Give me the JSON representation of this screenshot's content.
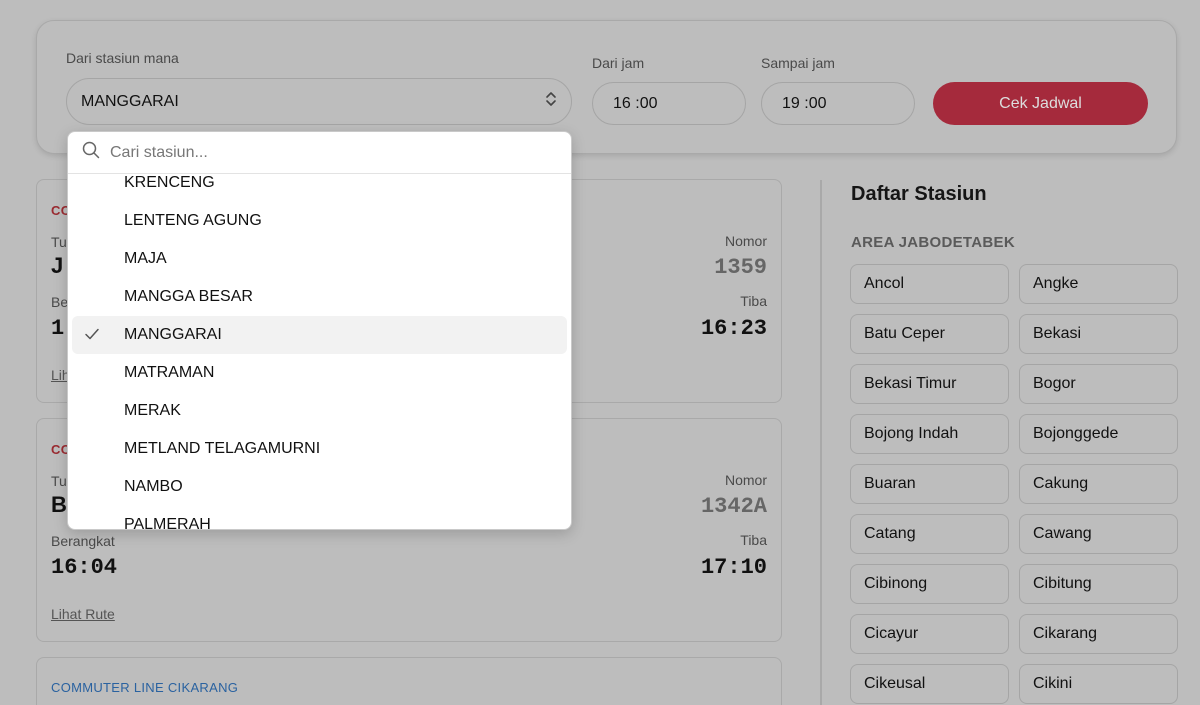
{
  "search": {
    "station_label": "Dari stasiun mana",
    "station_value": "MANGGARAI",
    "from_time_label": "Dari jam",
    "from_time_value": "16 :00",
    "to_time_label": "Sampai jam",
    "to_time_value": "19 :00",
    "submit_label": "Cek Jadwal"
  },
  "dropdown": {
    "placeholder": "Cari stasiun...",
    "items": [
      "KRENCENG",
      "LENTENG AGUNG",
      "MAJA",
      "MANGGA BESAR",
      "MANGGARAI",
      "MATRAMAN",
      "MERAK",
      "METLAND TELAGAMURNI",
      "NAMBO",
      "PALMERAH"
    ],
    "selected": "MANGGARAI"
  },
  "schedules": [
    {
      "line": "CO",
      "dest_label": "Tu",
      "dest": "J",
      "depart_label": "Be",
      "depart": "1",
      "number_label": "Nomor",
      "number": "1359",
      "arrive_label": "Tiba",
      "arrive": "16:23",
      "link": "Lih",
      "line_color": "#b02a30"
    },
    {
      "line": "CO",
      "dest_label": "Tu",
      "dest": "B",
      "depart_label": "Berangkat",
      "depart": "16:04",
      "number_label": "Nomor",
      "number": "1342A",
      "arrive_label": "Tiba",
      "arrive": "17:10",
      "link": "Lihat Rute",
      "line_color": "#b02a30"
    },
    {
      "line": "COMMUTER LINE CIKARANG",
      "line_color": "#2a6aa8"
    }
  ],
  "sidebar": {
    "title": "Daftar Stasiun",
    "area": "AREA JABODETABEK",
    "stations": [
      "Ancol",
      "Angke",
      "Batu Ceper",
      "Bekasi",
      "Bekasi Timur",
      "Bogor",
      "Bojong Indah",
      "Bojonggede",
      "Buaran",
      "Cakung",
      "Catang",
      "Cawang",
      "Cibinong",
      "Cibitung",
      "Cicayur",
      "Cikarang",
      "Cikeusal",
      "Cikini"
    ]
  },
  "colors": {
    "accent": "#c8354a",
    "overlay": "#bdbdbd"
  },
  "icons": {
    "select": "chevron-up-down-icon",
    "search": "search-icon",
    "check": "check-icon"
  }
}
